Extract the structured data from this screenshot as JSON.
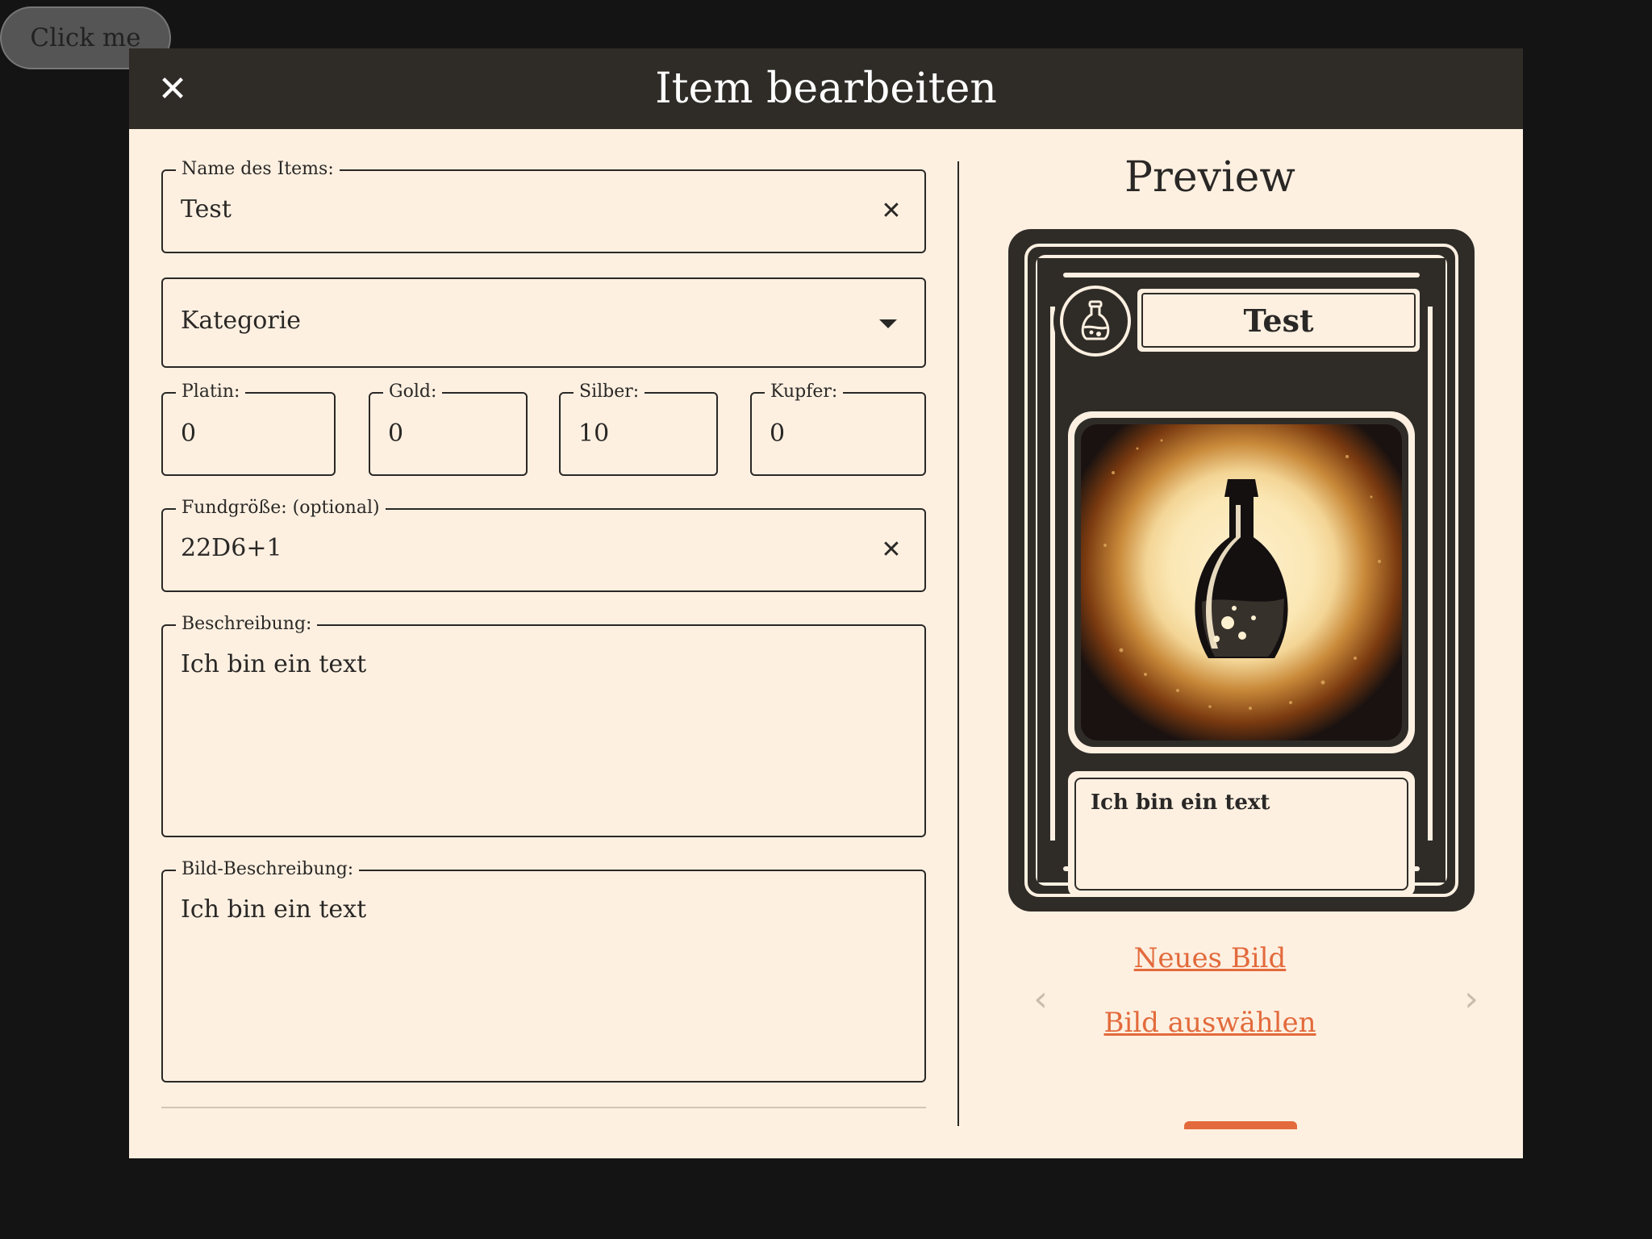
{
  "background_button": {
    "label": "Click me"
  },
  "modal": {
    "title": "Item bearbeiten",
    "close_icon": "close-icon"
  },
  "form": {
    "name": {
      "label": "Name des Items:",
      "value": "Test"
    },
    "category": {
      "value": "Kategorie"
    },
    "platin": {
      "label": "Platin:",
      "value": "0"
    },
    "gold": {
      "label": "Gold:",
      "value": "0"
    },
    "silber": {
      "label": "Silber:",
      "value": "10"
    },
    "kupfer": {
      "label": "Kupfer:",
      "value": "0"
    },
    "fundgroesse": {
      "label": "Fundgröße: (optional)",
      "value": "22D6+1"
    },
    "beschreibung": {
      "label": "Beschreibung:",
      "value": "Ich bin ein text"
    },
    "bild_beschreibung": {
      "label": "Bild-Beschreibung:",
      "value": "Ich bin ein text"
    }
  },
  "preview": {
    "title": "Preview",
    "card": {
      "title": "Test",
      "icon": "potion-icon",
      "image": "potion-bottle-image",
      "text": "Ich bin ein text"
    },
    "new_image_link": "Neues Bild",
    "select_image_link": "Bild auswählen",
    "prev_icon": "chevron-left-icon",
    "next_icon": "chevron-right-icon"
  },
  "colors": {
    "header_bg": "#2f2c28",
    "modal_bg": "#fdf0e1",
    "accent": "#e36a3c",
    "text": "#2a2826"
  }
}
